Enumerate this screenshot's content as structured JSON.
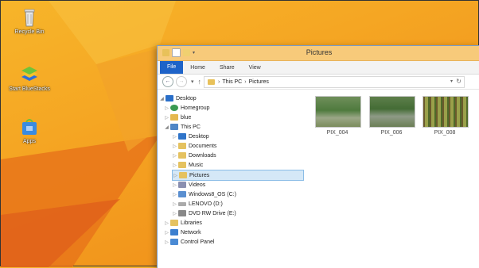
{
  "desktop": {
    "icons": [
      {
        "label": "Recycle Bin",
        "icon": "recycle-bin-icon"
      },
      {
        "label": "Start BlueStacks",
        "icon": "bluestacks-icon"
      },
      {
        "label": "Apps",
        "icon": "apps-icon"
      }
    ]
  },
  "window": {
    "title": "Pictures",
    "ribbon": {
      "file": "File",
      "tabs": [
        "Home",
        "Share",
        "View"
      ]
    },
    "address": {
      "path": [
        "This PC",
        "Pictures"
      ],
      "separator": "›"
    },
    "nav": {
      "items": [
        {
          "label": "Desktop",
          "icon": "desktop-icon",
          "arrow": "◢"
        },
        {
          "label": "Homegroup",
          "icon": "homegroup-icon",
          "arrow": "▷"
        },
        {
          "label": "blue",
          "icon": "user-folder-icon",
          "arrow": "▷"
        },
        {
          "label": "This PC",
          "icon": "computer-icon",
          "arrow": "◢"
        },
        {
          "label": "Desktop",
          "icon": "folder-icon",
          "arrow": "▷"
        },
        {
          "label": "Documents",
          "icon": "folder-icon",
          "arrow": "▷"
        },
        {
          "label": "Downloads",
          "icon": "folder-icon",
          "arrow": "▷"
        },
        {
          "label": "Music",
          "icon": "folder-icon",
          "arrow": "▷"
        },
        {
          "label": "Pictures",
          "icon": "folder-icon",
          "arrow": "▷"
        },
        {
          "label": "Videos",
          "icon": "folder-icon",
          "arrow": "▷"
        },
        {
          "label": "Windows8_OS (C:)",
          "icon": "drive-icon",
          "arrow": "▷"
        },
        {
          "label": "LENOVO (D:)",
          "icon": "drive-icon",
          "arrow": "▷"
        },
        {
          "label": "DVD RW Drive (E:)",
          "icon": "dvd-icon",
          "arrow": "▷"
        },
        {
          "label": "Libraries",
          "icon": "libraries-icon",
          "arrow": "▷"
        },
        {
          "label": "Network",
          "icon": "network-icon",
          "arrow": "▷"
        },
        {
          "label": "Control Panel",
          "icon": "control-panel-icon",
          "arrow": "▷"
        }
      ]
    },
    "files": [
      {
        "name": "PIX_004"
      },
      {
        "name": "PIX_006"
      },
      {
        "name": "PIX_008"
      }
    ]
  }
}
